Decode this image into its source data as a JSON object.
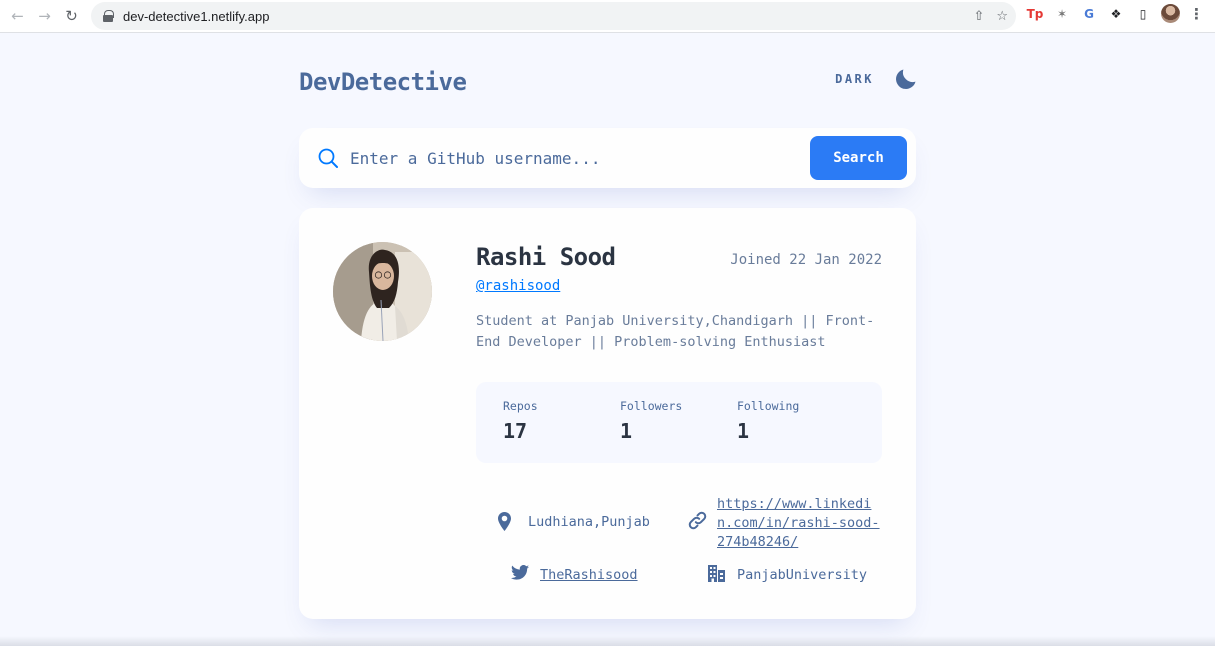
{
  "browser": {
    "url": "dev-detective1.netlify.app"
  },
  "app": {
    "logo": "DevDetective",
    "theme_label": "DARK",
    "search": {
      "placeholder": "Enter a GitHub username...",
      "button_label": "Search"
    },
    "profile": {
      "name": "Rashi Sood",
      "joined": "Joined 22 Jan 2022",
      "username": "@rashisood",
      "bio": "Student at Panjab University,Chandigarh || Front-End Developer || Problem-solving Enthusiast",
      "stats": {
        "repos_label": "Repos",
        "repos_value": "17",
        "followers_label": "Followers",
        "followers_value": "1",
        "following_label": "Following",
        "following_value": "1"
      },
      "location": "Ludhiana,Punjab",
      "website": "https://www.linkedin.com/in/rashi-sood-274b48246/",
      "twitter": "TheRashisood",
      "company": "PanjabUniversity"
    }
  },
  "colors": {
    "background": "#f6f8ff",
    "card": "#fefefe",
    "accent": "#2b7bf5",
    "text_primary": "#2b3442",
    "text_secondary": "#4b6a9b",
    "text_muted": "#697c9a",
    "link": "#0079ff"
  },
  "icons": [
    "back-arrow-icon",
    "forward-arrow-icon",
    "reload-icon",
    "lock-icon",
    "share-icon",
    "star-icon",
    "moon-icon",
    "search-icon",
    "location-icon",
    "link-icon",
    "twitter-icon",
    "company-icon"
  ]
}
